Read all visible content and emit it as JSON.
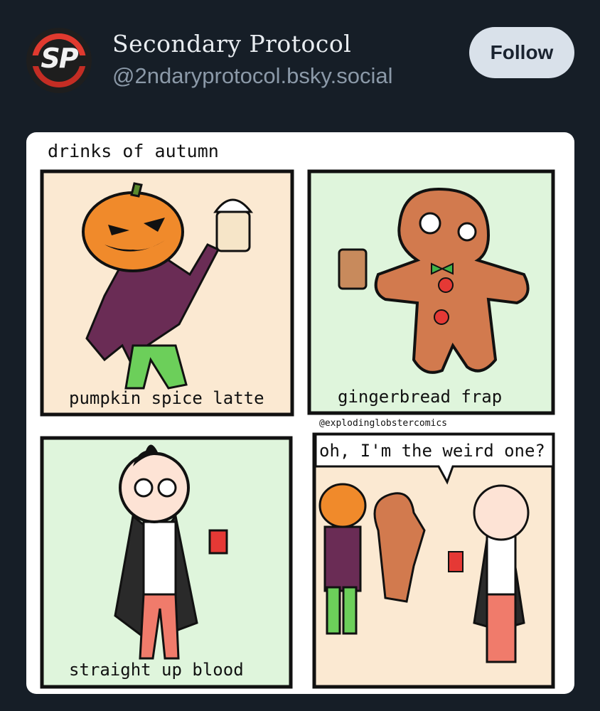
{
  "post": {
    "author_name": "Secondary Protocol",
    "author_handle": "@2ndaryprotocol.bsky.social",
    "avatar_initials": "SP",
    "follow_label": "Follow"
  },
  "comic": {
    "title": "drinks of autumn",
    "panels": [
      {
        "caption": "pumpkin spice latte"
      },
      {
        "caption": "gingerbread frap"
      },
      {
        "caption": "straight up blood"
      },
      {
        "speech": "oh, I'm the weird one?"
      }
    ],
    "credit": "@explodinglobstercomics"
  },
  "colors": {
    "background": "#161e27",
    "follow_bg": "#d9e1ea",
    "panel_peach": "#fbe9d2",
    "panel_mint": "#dff5dc",
    "avatar_red": "#e03a2f"
  }
}
